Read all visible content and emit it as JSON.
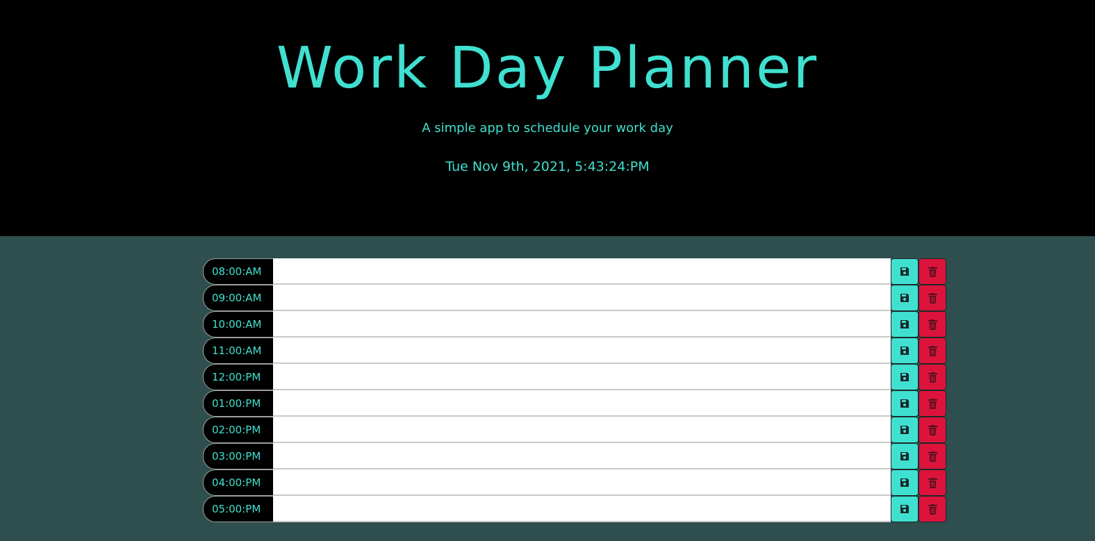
{
  "header": {
    "title": "Work Day Planner",
    "subtitle": "A simple app to schedule your work day",
    "datetime": "Tue Nov 9th, 2021, 5:43:24:PM"
  },
  "planner": {
    "rows": [
      {
        "hour": "08:00:AM",
        "task": ""
      },
      {
        "hour": "09:00:AM",
        "task": ""
      },
      {
        "hour": "10:00:AM",
        "task": ""
      },
      {
        "hour": "11:00:AM",
        "task": ""
      },
      {
        "hour": "12:00:PM",
        "task": ""
      },
      {
        "hour": "01:00:PM",
        "task": ""
      },
      {
        "hour": "02:00:PM",
        "task": ""
      },
      {
        "hour": "03:00:PM",
        "task": ""
      },
      {
        "hour": "04:00:PM",
        "task": ""
      },
      {
        "hour": "05:00:PM",
        "task": ""
      }
    ],
    "save_icon": "floppy-disk-icon",
    "delete_icon": "trash-icon"
  },
  "colors": {
    "accent": "#40e0d0",
    "header_bg": "#000000",
    "page_bg": "#2f4f4f",
    "delete": "#dc143c"
  }
}
